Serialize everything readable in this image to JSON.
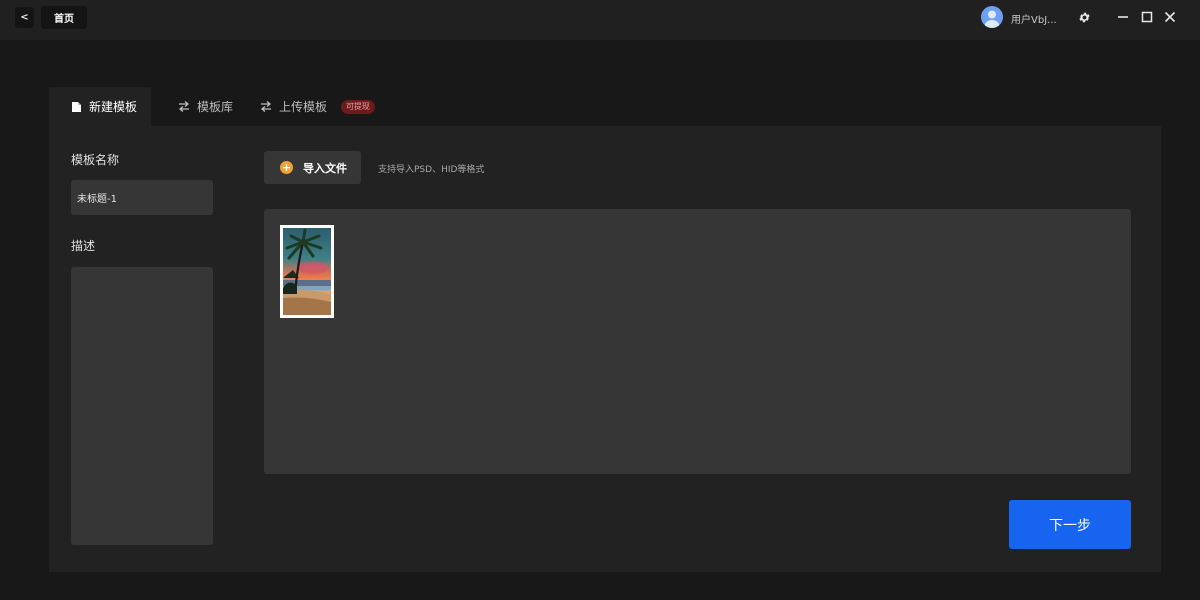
{
  "titlebar": {
    "back_label": "<",
    "home_tab_label": "首页",
    "username": "用户VbJ..."
  },
  "tabs": [
    {
      "label": "新建模板",
      "icon": "document-icon",
      "active": true
    },
    {
      "label": "模板库",
      "icon": "swap-icon",
      "active": false
    },
    {
      "label": "上传模板",
      "icon": "swap-icon",
      "active": false,
      "badge": "可提现"
    }
  ],
  "form": {
    "name_label": "模板名称",
    "name_value": "未标题-1",
    "description_label": "描述",
    "description_value": ""
  },
  "import": {
    "button_label": "导入文件",
    "hint": "支持导入PSD、HID等格式"
  },
  "preview": {
    "thumbnail": "beach-sunset-palm-image"
  },
  "actions": {
    "next_label": "下一步"
  },
  "colors": {
    "accent": "#1764f0",
    "badge_bg": "#6b1b1b",
    "import_icon": "#f0a23a"
  }
}
